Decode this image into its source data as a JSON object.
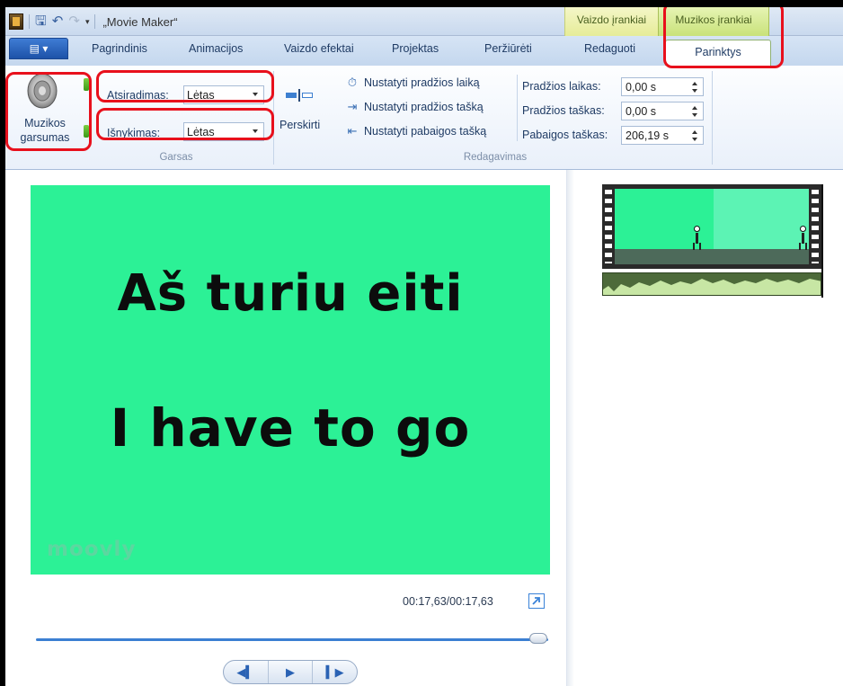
{
  "titlebar": {
    "title": "„Movie Maker“",
    "context_video": "Vaizdo įrankiai",
    "context_music": "Muzikos įrankiai"
  },
  "tabs": {
    "file": "▤ ▾",
    "items": [
      "Pagrindinis",
      "Animacijos",
      "Vaizdo efektai",
      "Projektas",
      "Peržiūrėti",
      "Redaguoti"
    ],
    "active": "Parinktys"
  },
  "ribbon": {
    "audio_group": {
      "volume_label_1": "Muzikos",
      "volume_label_2": "garsumas",
      "fadein_label": "Atsiradimas:",
      "fadein_value": "Lėtas",
      "fadeout_label": "Išnykimas:",
      "fadeout_value": "Lėtas",
      "group_label": "Garsas"
    },
    "edit_group": {
      "split_label": "Perskirti",
      "set_start_time": "Nustatyti pradžios laiką",
      "set_start_point": "Nustatyti pradžios tašką",
      "set_end_point": "Nustatyti pabaigos tašką",
      "start_time_label": "Pradžios laikas:",
      "start_time_value": "0,00 s",
      "start_point_label": "Pradžios taškas:",
      "start_point_value": "0,00 s",
      "end_point_label": "Pabaigos taškas:",
      "end_point_value": "206,19 s",
      "group_label": "Redagavimas"
    }
  },
  "preview": {
    "line1": "Aš turiu eiti",
    "line2": "I have to go",
    "watermark": "moovly",
    "background": "#2cf196",
    "time": "00:17,63/00:17,63",
    "progress": 1.0
  },
  "transport": {
    "prev": "◀▍",
    "play": "▶",
    "next": "▍▶"
  },
  "highlight_color": "#e8101c"
}
